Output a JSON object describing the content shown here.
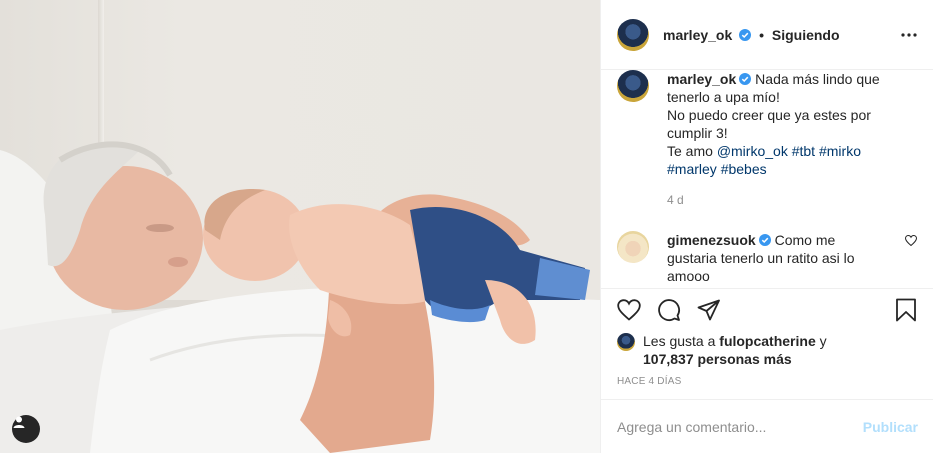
{
  "post": {
    "username": "marley_ok",
    "follow_status": "Siguiendo",
    "dot": "•"
  },
  "caption": {
    "username": "marley_ok",
    "lines": [
      "Nada más lindo que",
      "tenerlo a upa mío!",
      "No puedo creer que ya estes por",
      "cumplir 3!",
      "Te amo"
    ],
    "tags": [
      "@mirko_ok",
      "#tbt",
      "#mirko",
      "#marley",
      "#bebes"
    ],
    "time": "4 d"
  },
  "comment": {
    "username": "gimenezsuok",
    "text_line1": "Como me",
    "text_line2": "gustaria tenerlo un ratito asi lo",
    "text_line3": "amooo"
  },
  "likes": {
    "prefix": "Les gusta a",
    "user": "fulopcatherine",
    "conj": "y",
    "count": "107,837 personas más"
  },
  "date": "Hace 4 días",
  "add_comment": {
    "placeholder": "Agrega un comentario...",
    "publish_label": "Publicar"
  },
  "colors": {
    "text": "#262626",
    "secondary": "#8e8e8e",
    "link": "#00376b",
    "verified": "#3897f0",
    "publish_disabled": "#b2dffc"
  },
  "icons": [
    "more-options-icon",
    "verified-badge-icon",
    "heart-icon",
    "comment-icon",
    "share-icon",
    "bookmark-icon",
    "user-tag-icon"
  ]
}
